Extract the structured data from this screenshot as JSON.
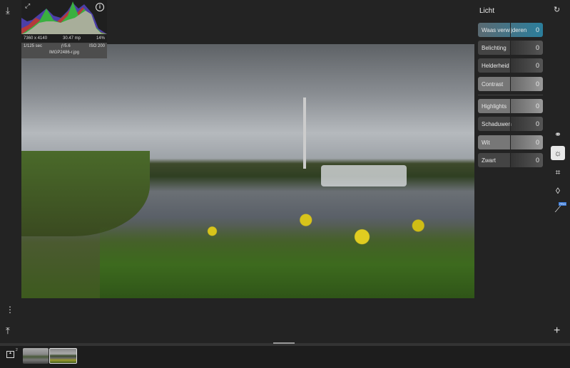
{
  "histogram": {
    "dimensions": "7360 x 4140",
    "megapixels": "30.47 mp",
    "zoom": "14%",
    "shutter": "1/125 sec",
    "aperture": "ƒ/5.6",
    "iso": "ISO 200",
    "filename": "IMGP2486-r.jpg"
  },
  "panel": {
    "title": "Licht",
    "sliders": [
      {
        "label": "Waas verwijderen",
        "value": "0"
      },
      {
        "label": "Belichting",
        "value": "0"
      },
      {
        "label": "Helderheid",
        "value": "0"
      },
      {
        "label": "Contrast",
        "value": "0"
      },
      {
        "label": "Highlights",
        "value": "0"
      },
      {
        "label": "Schaduwen",
        "value": "0"
      },
      {
        "label": "Wit",
        "value": "0"
      },
      {
        "label": "Zwart",
        "value": "0"
      }
    ]
  },
  "tools": {
    "pro_badge": "PRO"
  },
  "filmstrip": {
    "count": "2"
  },
  "colors": {
    "accent": "#2b7e9c",
    "background": "#232323"
  }
}
